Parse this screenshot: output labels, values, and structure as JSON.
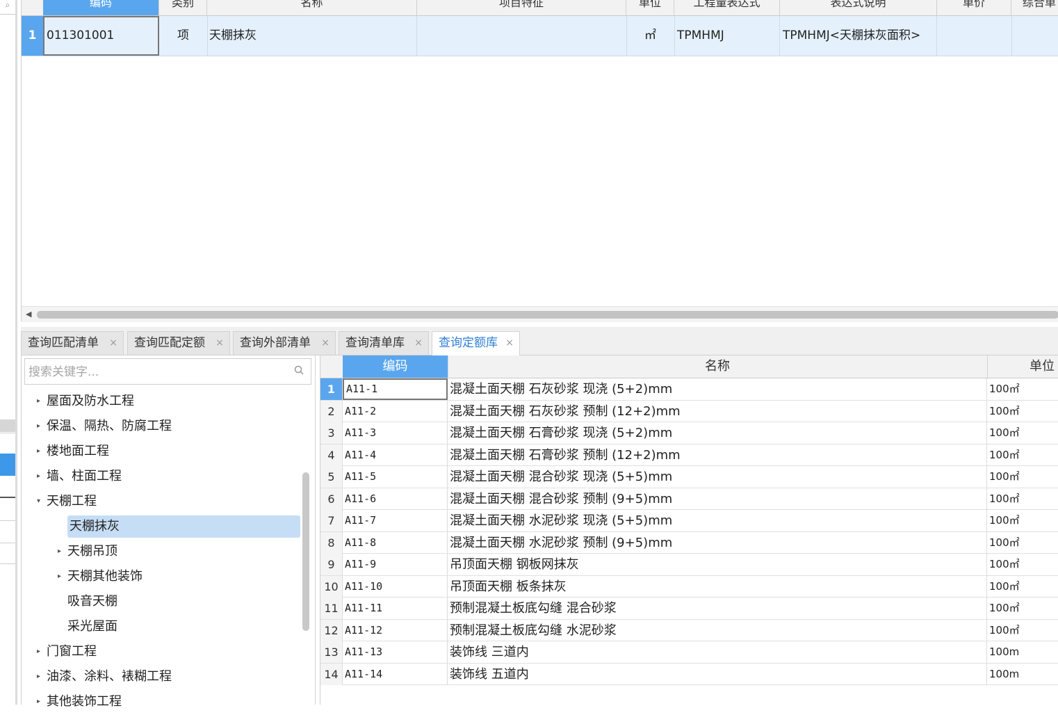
{
  "top_grid": {
    "columns": [
      "编码",
      "类别",
      "名称",
      "项目特征",
      "单位",
      "工程量表达式",
      "表达式说明",
      "单价",
      "综合单"
    ],
    "row": {
      "index": "1",
      "code": "011301001",
      "category": "项",
      "name": "天棚抹灰",
      "feature": "",
      "unit": "㎡",
      "expression": "TPMHMJ",
      "expression_desc": "TPMHMJ<天棚抹灰面积>",
      "price": "",
      "total": ""
    }
  },
  "tabs": [
    {
      "label": "查询匹配清单",
      "active": false
    },
    {
      "label": "查询匹配定额",
      "active": false
    },
    {
      "label": "查询外部清单",
      "active": false
    },
    {
      "label": "查询清单库",
      "active": false
    },
    {
      "label": "查询定额库",
      "active": true
    }
  ],
  "tab_close": "×",
  "tree": {
    "search_placeholder": "搜索关键字...",
    "items": [
      {
        "label": "屋面及防水工程",
        "level": 0,
        "expander": "▸"
      },
      {
        "label": "保温、隔热、防腐工程",
        "level": 0,
        "expander": "▸"
      },
      {
        "label": "楼地面工程",
        "level": 0,
        "expander": "▸"
      },
      {
        "label": "墙、柱面工程",
        "level": 0,
        "expander": "▸"
      },
      {
        "label": "天棚工程",
        "level": 0,
        "expander": "▾"
      },
      {
        "label": "天棚抹灰",
        "level": 1,
        "expander": "",
        "selected": true
      },
      {
        "label": "天棚吊顶",
        "level": 1,
        "expander": "▸"
      },
      {
        "label": "天棚其他装饰",
        "level": 1,
        "expander": "▸"
      },
      {
        "label": "吸音天棚",
        "level": 1,
        "expander": ""
      },
      {
        "label": "采光屋面",
        "level": 1,
        "expander": ""
      },
      {
        "label": "门窗工程",
        "level": 0,
        "expander": "▸"
      },
      {
        "label": "油漆、涂料、裱糊工程",
        "level": 0,
        "expander": "▸"
      },
      {
        "label": "其他装饰工程",
        "level": 0,
        "expander": "▸"
      }
    ]
  },
  "quota_grid": {
    "columns": [
      "编码",
      "名称",
      "单位"
    ],
    "rows": [
      {
        "num": "1",
        "code": "A11-1",
        "name": "混凝土面天棚 石灰砂浆 现浇 (5+2)mm",
        "unit": "100㎡"
      },
      {
        "num": "2",
        "code": "A11-2",
        "name": "混凝土面天棚 石灰砂浆 预制 (12+2)mm",
        "unit": "100㎡"
      },
      {
        "num": "3",
        "code": "A11-3",
        "name": "混凝土面天棚 石膏砂浆 现浇 (5+2)mm",
        "unit": "100㎡"
      },
      {
        "num": "4",
        "code": "A11-4",
        "name": "混凝土面天棚 石膏砂浆 预制 (12+2)mm",
        "unit": "100㎡"
      },
      {
        "num": "5",
        "code": "A11-5",
        "name": "混凝土面天棚 混合砂浆 现浇 (5+5)mm",
        "unit": "100㎡"
      },
      {
        "num": "6",
        "code": "A11-6",
        "name": "混凝土面天棚 混合砂浆 预制 (9+5)mm",
        "unit": "100㎡"
      },
      {
        "num": "7",
        "code": "A11-7",
        "name": "混凝土面天棚 水泥砂浆 现浇 (5+5)mm",
        "unit": "100㎡"
      },
      {
        "num": "8",
        "code": "A11-8",
        "name": "混凝土面天棚 水泥砂浆 预制 (9+5)mm",
        "unit": "100㎡"
      },
      {
        "num": "9",
        "code": "A11-9",
        "name": "吊顶面天棚 钢板网抹灰",
        "unit": "100㎡"
      },
      {
        "num": "10",
        "code": "A11-10",
        "name": "吊顶面天棚 板条抹灰",
        "unit": "100㎡"
      },
      {
        "num": "11",
        "code": "A11-11",
        "name": "预制混凝土板底勾缝 混合砂浆",
        "unit": "100㎡"
      },
      {
        "num": "12",
        "code": "A11-12",
        "name": "预制混凝土板底勾缝 水泥砂浆",
        "unit": "100㎡"
      },
      {
        "num": "13",
        "code": "A11-13",
        "name": "装饰线 三道内",
        "unit": "100m"
      },
      {
        "num": "14",
        "code": "A11-14",
        "name": "装饰线 五道内",
        "unit": "100m"
      }
    ]
  },
  "colors": {
    "accent": "#5aa6ee",
    "selection": "#c6def5",
    "active_tab_text": "#2f7fd4"
  }
}
